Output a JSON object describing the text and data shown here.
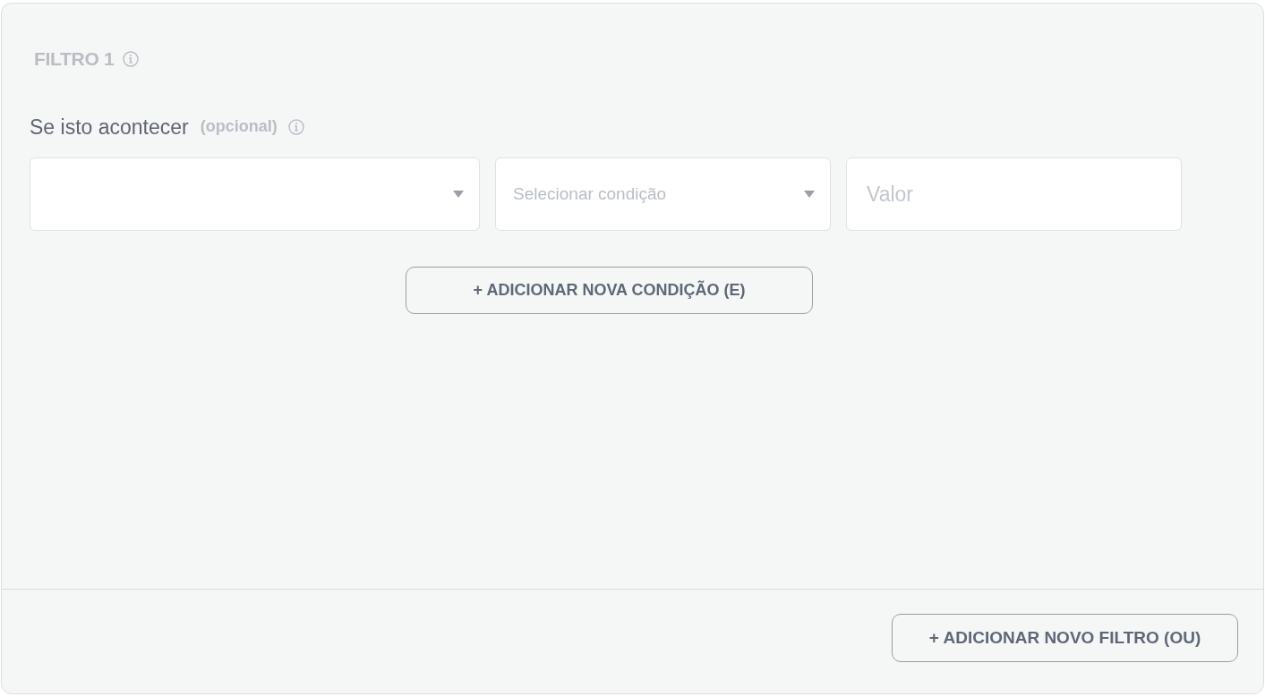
{
  "filter": {
    "title": "FILTRO 1",
    "condition_label": "Se isto acontecer",
    "optional_tag": "(opcional)",
    "fields": [
      {
        "kind": "select"
      },
      {
        "kind": "select",
        "placeholder": "Selecionar condição"
      },
      {
        "kind": "input",
        "placeholder": "Valor"
      }
    ],
    "add_condition_button": "+ ADICIONAR NOVA CONDIÇÃO (E)"
  },
  "footer": {
    "add_filter_button": "+ ADICIONAR NOVO FILTRO (OU)"
  }
}
